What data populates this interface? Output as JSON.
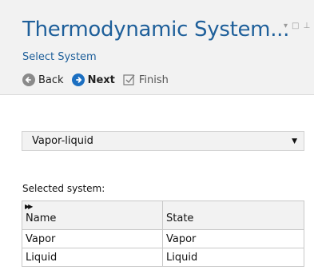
{
  "window": {
    "title": "Thermodynamic System...",
    "controls": [
      "▾",
      "□",
      "⊥"
    ]
  },
  "header": {
    "subtitle": "Select System"
  },
  "nav": {
    "back_label": "Back",
    "next_label": "Next",
    "finish_label": "Finish"
  },
  "system_select": {
    "selected_value": "Vapor-liquid"
  },
  "selected_system": {
    "label": "Selected system:",
    "columns": [
      "Name",
      "State"
    ],
    "rows": [
      [
        "Vapor",
        "Vapor"
      ],
      [
        "Liquid",
        "Liquid"
      ]
    ]
  },
  "colors": {
    "title_blue": "#1e5f9a",
    "next_blue": "#1c6fc1",
    "back_gray": "#8a8a8a"
  }
}
